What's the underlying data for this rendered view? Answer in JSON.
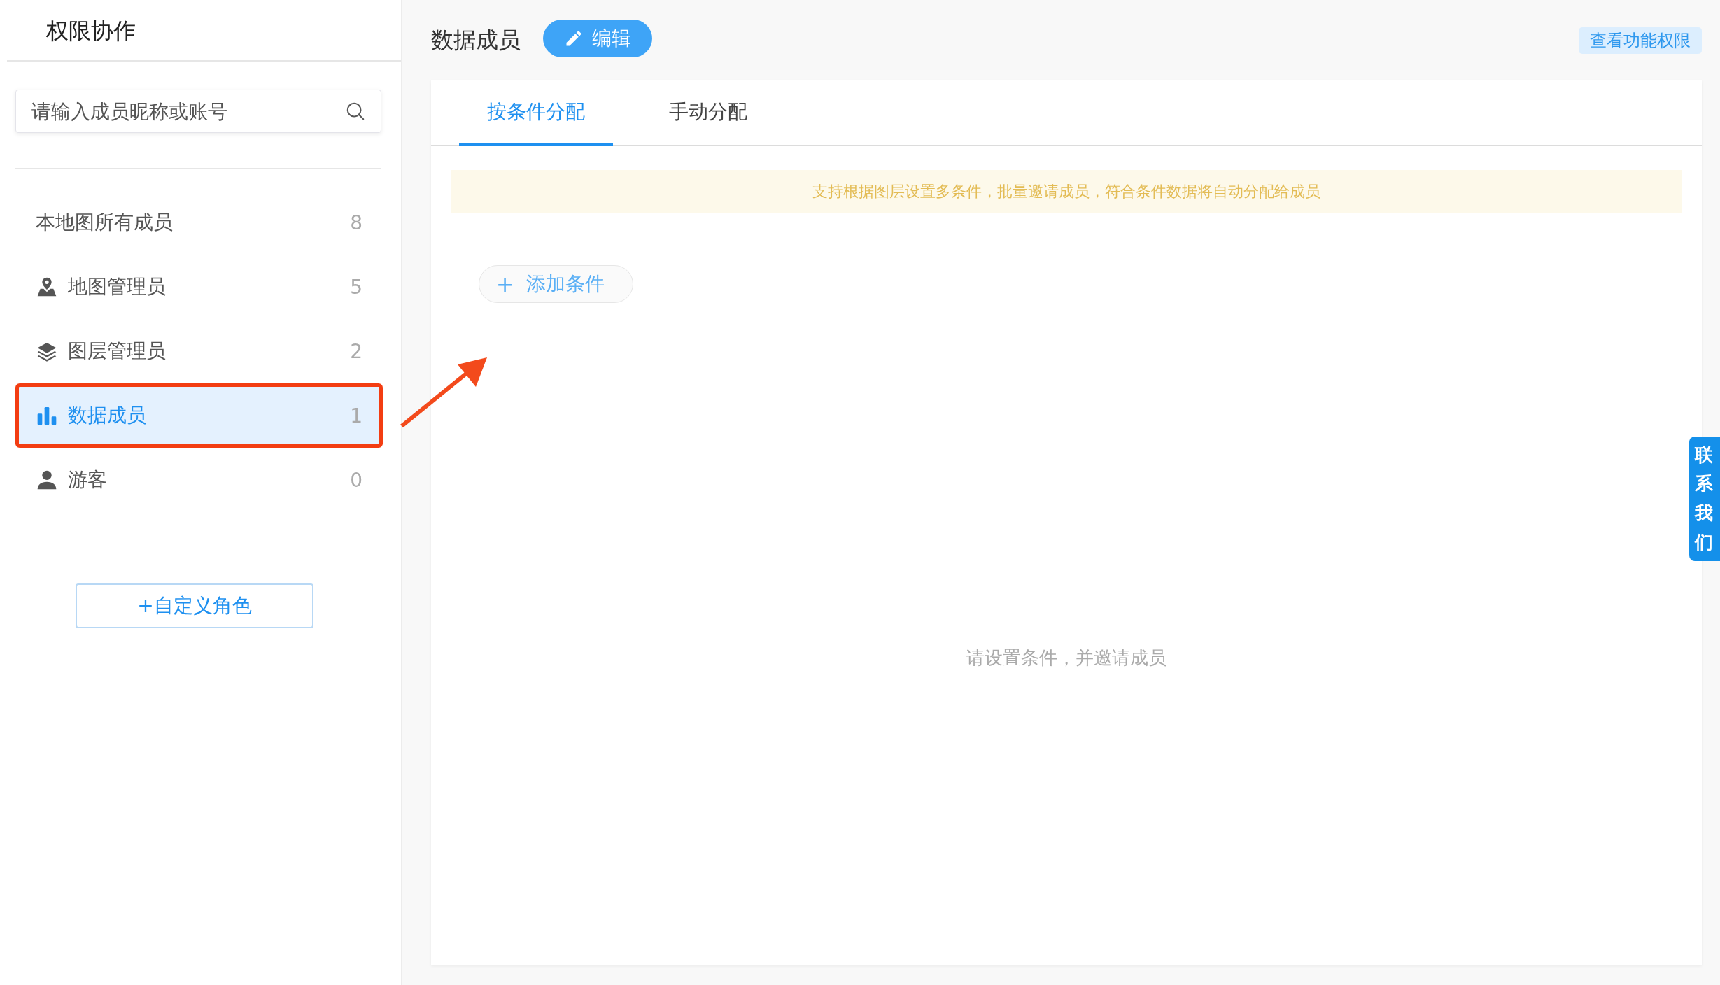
{
  "sidebar": {
    "title": "权限协作",
    "search": {
      "placeholder": "请输入成员昵称或账号"
    },
    "roles": [
      {
        "kind": "plain",
        "label": "本地图所有成员",
        "count": "8",
        "selected": false,
        "highlighted": false
      },
      {
        "kind": "map-pin",
        "label": "地图管理员",
        "count": "5",
        "selected": false,
        "highlighted": false
      },
      {
        "kind": "layers",
        "label": "图层管理员",
        "count": "2",
        "selected": false,
        "highlighted": false
      },
      {
        "kind": "bar-chart",
        "label": "数据成员",
        "count": "1",
        "selected": true,
        "highlighted": true
      },
      {
        "kind": "person",
        "label": "游客",
        "count": "0",
        "selected": false,
        "highlighted": false
      }
    ],
    "add_role_button": "+自定义角色"
  },
  "header": {
    "title": "数据成员",
    "edit_button": "编辑",
    "permissions_link": "查看功能权限"
  },
  "tabs": [
    {
      "label": "按条件分配",
      "selected": true
    },
    {
      "label": "手动分配",
      "selected": false
    }
  ],
  "notice": "支持根据图层设置多条件，批量邀请成员，符合条件数据将自动分配给成员",
  "add_condition_button": {
    "icon": "+",
    "label": "添加条件"
  },
  "empty_message": "请设置条件，并邀请成员",
  "contact_tab": "联系我们"
}
